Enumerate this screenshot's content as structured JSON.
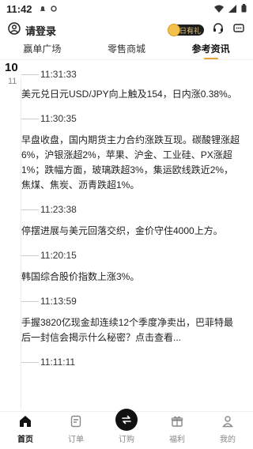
{
  "status_bar": {
    "time": "11:42"
  },
  "header": {
    "login_label": "请登录",
    "badge_text": "每日有礼"
  },
  "tabs": [
    {
      "label": "赢单广场"
    },
    {
      "label": "零售商城"
    },
    {
      "label": "参考资讯"
    }
  ],
  "date": {
    "day": "10",
    "month": "11"
  },
  "news": [
    {
      "time": "11:31:33",
      "text": "美元兑日元USD/JPY向上触及154，日内涨0.38%。"
    },
    {
      "time": "11:30:35",
      "text": "早盘收盘，国内期货主力合约涨跌互现。碳酸锂涨超6%，沪银涨超2%，苹果、沪金、工业硅、PX涨超1%；跌幅方面，玻璃跌超3%，集运欧线跌近2%，焦煤、焦炭、沥青跌超1%。"
    },
    {
      "time": "11:23:38",
      "text": "停摆进展与美元回落交织，金价守住4000上方。"
    },
    {
      "time": "11:20:15",
      "text": "韩国综合股价指数上涨3%。"
    },
    {
      "time": "11:13:59",
      "text": "手握3820亿现金却连续12个季度净卖出，巴菲特最后一封信会揭示什么秘密？点击查看..."
    },
    {
      "time": "11:11:11",
      "text": ""
    }
  ],
  "bottom_nav": [
    {
      "label": "首页"
    },
    {
      "label": "订单"
    },
    {
      "label": "订购"
    },
    {
      "label": "福利"
    },
    {
      "label": "我的"
    }
  ]
}
